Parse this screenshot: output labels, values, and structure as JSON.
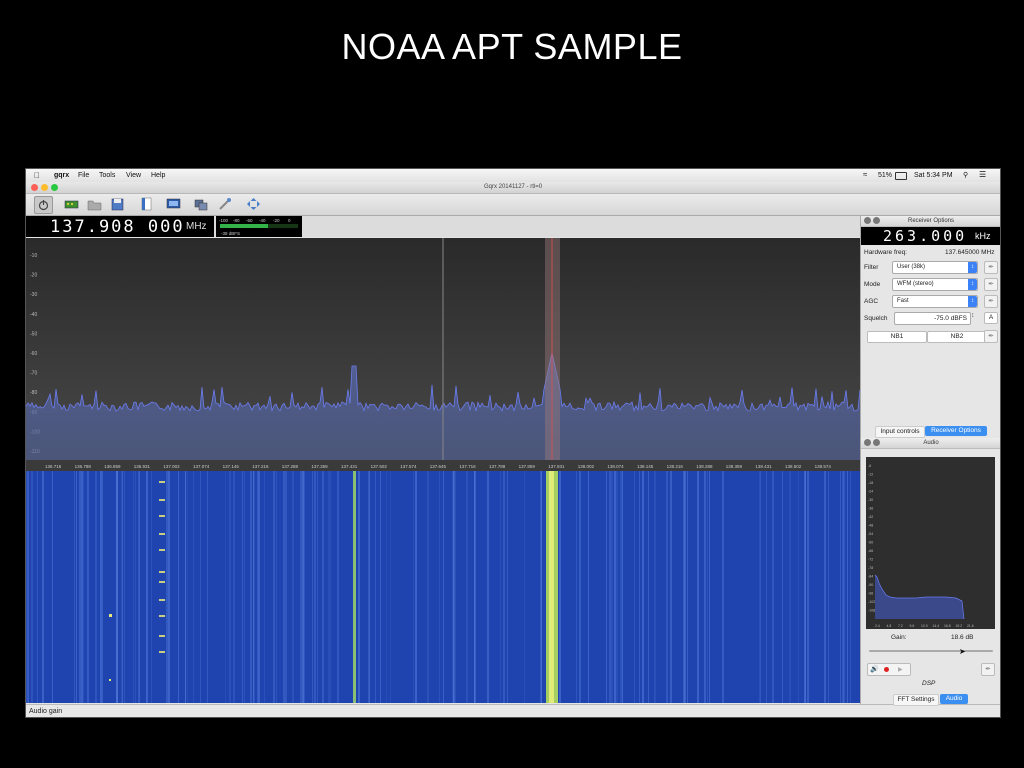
{
  "slide": {
    "title": "NOAA APT SAMPLE"
  },
  "menubar": {
    "app": "gqrx",
    "items": [
      "File",
      "Tools",
      "View",
      "Help"
    ],
    "wifi_battery": "51%",
    "clock": "Sat 5:34 PM"
  },
  "window": {
    "title": "Gqrx 20141127 - rtl=0"
  },
  "toolbar": {
    "buttons": [
      "power-icon",
      "hardware-icon",
      "open-icon",
      "save-icon",
      "document-icon",
      "display-icon",
      "network-icon",
      "tools-icon",
      "arrows-icon"
    ]
  },
  "frequency": {
    "digits": "137.908 000",
    "unit": "MHz"
  },
  "meter": {
    "ticks": [
      "-100",
      "-80",
      "-60",
      "-40",
      "-20",
      "0"
    ],
    "readout": "-38 dBFS"
  },
  "spectrum": {
    "db_labels": [
      "-10",
      "-20",
      "-30",
      "-40",
      "-50",
      "-60",
      "-70",
      "-80",
      "-90",
      "-100",
      "-110"
    ],
    "freq_labels": [
      "136.716",
      "136.788",
      "136.859",
      "136.931",
      "137.002",
      "137.074",
      "137.145",
      "137.216",
      "137.288",
      "137.359",
      "137.431",
      "137.502",
      "137.574",
      "137.645",
      "137.716",
      "137.788",
      "137.859",
      "137.931",
      "138.002",
      "138.074",
      "138.145",
      "138.216",
      "138.288",
      "138.359",
      "138.431",
      "138.502",
      "138.574"
    ]
  },
  "receiver_options": {
    "panel_title": "Receiver Options",
    "offset": "263.000",
    "offset_unit": "kHz",
    "hw_freq_label": "Hardware freq:",
    "hw_freq_value": "137.645000 MHz",
    "filter_label": "Filter",
    "filter_value": "User (38k)",
    "mode_label": "Mode",
    "mode_value": "WFM (stereo)",
    "agc_label": "AGC",
    "agc_value": "Fast",
    "squelch_label": "Squelch",
    "squelch_value": "-75.0 dBFS",
    "squelch_auto": "A",
    "nb1": "NB1",
    "nb2": "NB2",
    "tab_input": "Input controls",
    "tab_receiver": "Receiver Options"
  },
  "audio": {
    "panel_title": "Audio",
    "db_labels": [
      "-6",
      "-12",
      "-18",
      "-24",
      "-30",
      "-36",
      "-42",
      "-48",
      "-54",
      "-60",
      "-66",
      "-72",
      "-78",
      "-84",
      "-90",
      "-96",
      "-102",
      "-108"
    ],
    "freq_labels": [
      "2.4",
      "4.8",
      "7.2",
      "9.6",
      "12.0",
      "14.4",
      "16.8",
      "19.2",
      "21.6"
    ],
    "gain_label": "Gain:",
    "gain_value": "18.6 dB",
    "dsp_label": "DSP",
    "tab_fft": "FFT Settings",
    "tab_audio": "Audio"
  },
  "status_bar": {
    "text": "Audio gain"
  }
}
